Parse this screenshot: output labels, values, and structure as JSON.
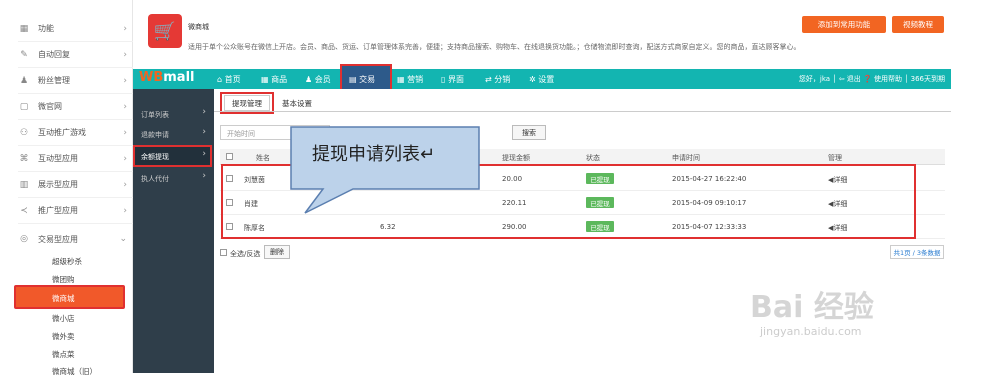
{
  "sidebar": {
    "items": [
      {
        "label": "功能",
        "icon": "grid-icon"
      },
      {
        "label": "自动回复",
        "icon": "reply-icon"
      },
      {
        "label": "粉丝管理",
        "icon": "fans-icon"
      },
      {
        "label": "微官网",
        "icon": "page-icon"
      },
      {
        "label": "互动推广游戏",
        "icon": "gamepad-icon"
      },
      {
        "label": "互动型应用",
        "icon": "cmd-icon"
      },
      {
        "label": "展示型应用",
        "icon": "book-icon"
      },
      {
        "label": "推广型应用",
        "icon": "share-icon"
      },
      {
        "label": "交易型应用",
        "icon": "trade-icon"
      }
    ],
    "subitems": [
      "超级秒杀",
      "微团购",
      "微商城",
      "微小店",
      "微外卖",
      "微点菜",
      "微商城（旧）"
    ]
  },
  "header": {
    "title": "微商城",
    "desc": "适用于单个公众账号在微信上开店。会员、商品、货运、订单管理体系完善，便捷；支持商品搜索、购物车、在线退换货功能。；仓储物流即时查询，配送方式商家自定义。您的商品，直达顾客掌心。",
    "btn_add": "添加到常用功能",
    "btn_video": "视频教程"
  },
  "nav": {
    "logo_a": "WB",
    "logo_b": "mall",
    "items": [
      "首页",
      "商品",
      "会员",
      "交易",
      "营销",
      "界面",
      "分销",
      "设置"
    ],
    "right": "您好，jka │ ⇦ 退出 ❓ 使用帮助 │ 366天到期"
  },
  "left_menu": [
    "订单列表",
    "退款申请",
    "余额提现",
    "执人代付"
  ],
  "tabs": [
    "提现管理",
    "基本设置"
  ],
  "filter": {
    "date_placeholder": "开始时间",
    "search": "搜索"
  },
  "table": {
    "headers": [
      "姓名",
      "提现金额",
      "状态",
      "申请时间",
      "管理"
    ],
    "rows": [
      {
        "name": "刘慧茵",
        "col2": "",
        "amount": "20.00",
        "status": "已提现",
        "time": "2015-04-27 16:22:40",
        "action": "详细"
      },
      {
        "name": "肖建",
        "col2": "",
        "amount": "220.11",
        "status": "已提现",
        "time": "2015-04-09 09:10:17",
        "action": "详细"
      },
      {
        "name": "陈厚名",
        "col2": "6.32",
        "amount": "290.00",
        "status": "已提现",
        "time": "2015-04-07 12:33:33",
        "action": "详细"
      }
    ]
  },
  "footer": {
    "select_all": "全选/反选",
    "delete": "删除",
    "pager": "共1页 / 3条数据"
  },
  "callout": "提现申请列表↵",
  "watermark": {
    "main": "Bai 经验",
    "url": "jingyan.baidu.com"
  },
  "colors": {
    "teal": "#13b5b1",
    "orange": "#f26522",
    "red_highlight": "#e03030",
    "dark_menu": "#2f3e4a",
    "status_green": "#5cb85c"
  }
}
